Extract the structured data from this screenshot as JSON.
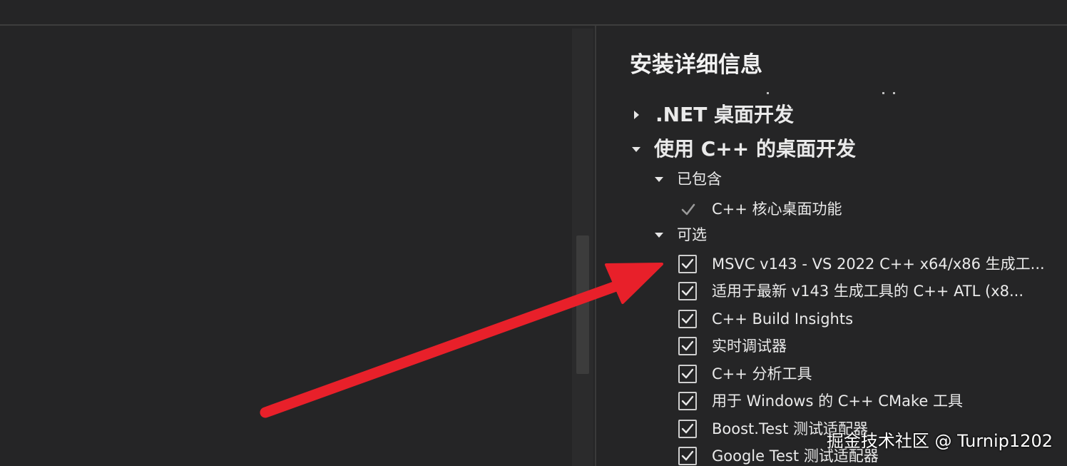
{
  "panel": {
    "title": "安装详细信息"
  },
  "workloads": [
    {
      "label": ".NET 桌面开发",
      "expanded": false
    },
    {
      "label": "使用 C++ 的桌面开发",
      "expanded": true
    }
  ],
  "included": {
    "label": "已包含",
    "items": [
      {
        "label": "C++ 核心桌面功能",
        "checked": true,
        "disabled": true
      }
    ]
  },
  "optional": {
    "label": "可选",
    "items": [
      {
        "label": "MSVC v143 - VS 2022 C++ x64/x86 生成工...",
        "checked": true
      },
      {
        "label": "适用于最新 v143 生成工具的 C++ ATL (x8...",
        "checked": true
      },
      {
        "label": "C++ Build Insights",
        "checked": true
      },
      {
        "label": "实时调试器",
        "checked": true
      },
      {
        "label": "C++ 分析工具",
        "checked": true
      },
      {
        "label": "用于 Windows 的 C++ CMake 工具",
        "checked": true
      },
      {
        "label": "Boost.Test 测试适配器",
        "checked": true
      },
      {
        "label": "Google Test 测试适配器",
        "checked": true
      }
    ]
  },
  "annotation": {
    "arrow_color": "#e8202a"
  },
  "watermark": {
    "text": "掘金技术社区 @ Turnip1202"
  },
  "colors": {
    "background": "#252526",
    "text": "#eaeaea",
    "divider": "#3a3a3a"
  }
}
